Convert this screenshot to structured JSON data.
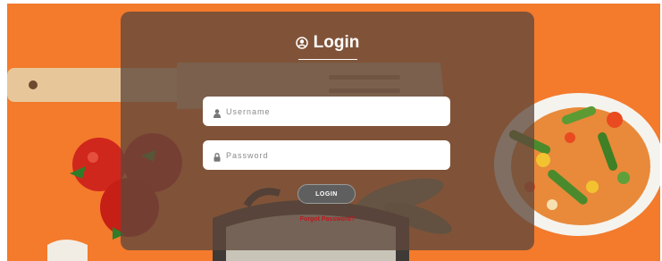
{
  "login_form": {
    "title": "Login",
    "username_placeholder": "Username",
    "password_placeholder": "Password",
    "submit_label": "LOGIN",
    "forgot_link": "Forgot Password?"
  },
  "icons": {
    "title": "user-circle-icon",
    "username": "user-icon",
    "password": "lock-icon"
  },
  "colors": {
    "background": "#f47a2c",
    "panel_overlay": "rgba(95,72,60,0.78)",
    "button": "#5f5f5f",
    "forgot_link": "#c0161c"
  }
}
